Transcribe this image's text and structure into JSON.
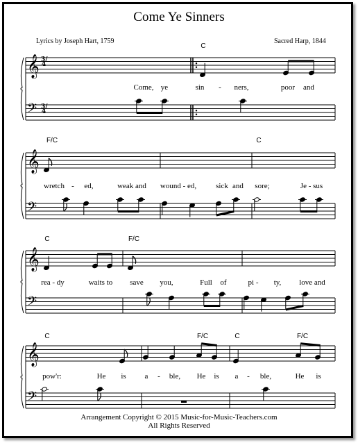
{
  "title": "Come Ye Sinners",
  "lyricist": "Lyrics by Joseph Hart, 1759",
  "source": "Sacred Harp,  1844",
  "time_signature": "3/4",
  "systems": [
    {
      "chords": [
        "C"
      ],
      "lyrics": [
        "Come,",
        "ye",
        "sin",
        "-",
        "ners,",
        "poor",
        "and"
      ]
    },
    {
      "chords": [
        "F/C",
        "C"
      ],
      "lyrics": [
        "wretch",
        "-",
        "ed,",
        "weak and",
        "wound - ed,",
        "sick",
        "and",
        "sore;",
        "Je - sus"
      ]
    },
    {
      "chords": [
        "C",
        "F/C"
      ],
      "lyrics": [
        "rea - dy",
        "waits to",
        "save",
        "you,",
        "Full",
        "of",
        "pi -",
        "ty,",
        "love and"
      ]
    },
    {
      "chords": [
        "C",
        "F/C",
        "C",
        "F/C"
      ],
      "lyrics": [
        "pow'r:",
        "He",
        "is",
        "a",
        "-",
        "ble,",
        "He",
        "is",
        "a",
        "-",
        "ble,",
        "He",
        "is"
      ]
    }
  ],
  "footer": {
    "copyright": "Arrangement Copyright  © 2015 Music-for-Music-Teachers.com",
    "rights": "All Rights Reserved"
  }
}
